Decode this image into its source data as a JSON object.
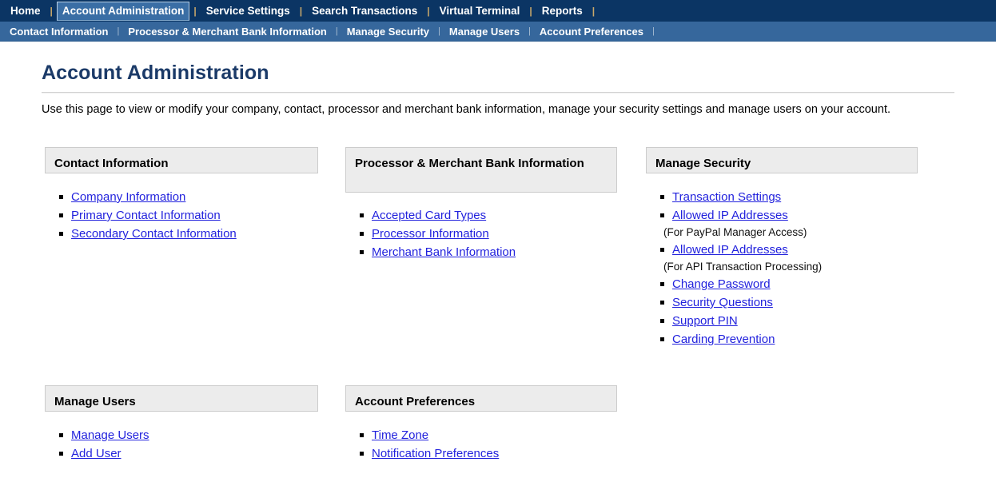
{
  "nav_primary": {
    "items": [
      {
        "label": "Home",
        "active": false
      },
      {
        "label": "Account Administration",
        "active": true
      },
      {
        "label": "Service Settings",
        "active": false
      },
      {
        "label": "Search Transactions",
        "active": false
      },
      {
        "label": "Virtual Terminal",
        "active": false
      },
      {
        "label": "Reports",
        "active": false
      }
    ],
    "separator": "|"
  },
  "nav_secondary": {
    "items": [
      {
        "label": "Contact Information"
      },
      {
        "label": "Processor & Merchant Bank Information"
      },
      {
        "label": "Manage Security"
      },
      {
        "label": "Manage Users"
      },
      {
        "label": "Account Preferences"
      }
    ],
    "separator": "|"
  },
  "page": {
    "title": "Account Administration",
    "description": "Use this page to view or modify your company, contact, processor and merchant bank information, manage your security settings and manage users on your account."
  },
  "cards": {
    "contact": {
      "header": "Contact Information",
      "links": [
        "Company Information",
        "Primary Contact Information",
        "Secondary Contact Information"
      ]
    },
    "processor": {
      "header": "Processor & Merchant Bank Information",
      "links": [
        "Accepted Card Types",
        "Processor Information",
        "Merchant Bank Information"
      ]
    },
    "security": {
      "header": "Manage Security",
      "items": [
        {
          "type": "link",
          "label": "Transaction Settings"
        },
        {
          "type": "link",
          "label": "Allowed IP Addresses"
        },
        {
          "type": "note",
          "label": "(For PayPal Manager Access)"
        },
        {
          "type": "link",
          "label": "Allowed IP Addresses"
        },
        {
          "type": "note",
          "label": "(For API Transaction Processing)"
        },
        {
          "type": "link",
          "label": "Change Password"
        },
        {
          "type": "link",
          "label": "Security Questions"
        },
        {
          "type": "link",
          "label": "Support PIN"
        },
        {
          "type": "link",
          "label": "Carding Prevention"
        }
      ]
    },
    "users": {
      "header": "Manage Users",
      "links": [
        "Manage Users",
        "Add User"
      ]
    },
    "preferences": {
      "header": "Account Preferences",
      "links": [
        "Time Zone",
        "Notification Preferences"
      ]
    }
  },
  "colors": {
    "nav_primary_bg": "#0b3564",
    "nav_secondary_bg": "#36679c",
    "active_tab_bg": "#3a6ea5",
    "title_color": "#1b3a68",
    "link_color": "#2222dd",
    "card_header_bg": "#ececec",
    "card_border": "#cccccc"
  }
}
